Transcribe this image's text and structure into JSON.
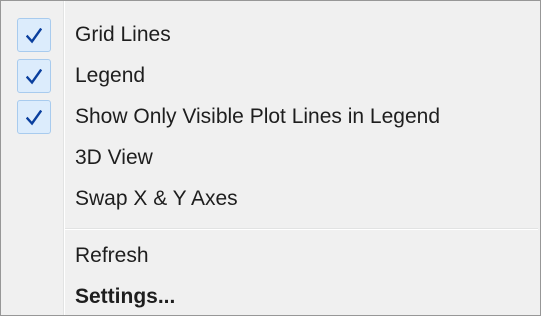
{
  "menu": {
    "accent_color": "#0a3f9e",
    "check_bg_color": "#dcecfc",
    "items": [
      {
        "label": "Grid Lines",
        "checked": true,
        "icon": "checkmark-icon"
      },
      {
        "label": "Legend",
        "checked": true,
        "icon": "checkmark-icon"
      },
      {
        "label": "Show Only Visible Plot Lines in Legend",
        "checked": true,
        "icon": "checkmark-icon"
      },
      {
        "label": "3D View",
        "checked": false
      },
      {
        "label": "Swap X & Y Axes",
        "checked": false
      },
      {
        "label": "Refresh"
      },
      {
        "label": "Settings...",
        "bold": true
      }
    ]
  }
}
